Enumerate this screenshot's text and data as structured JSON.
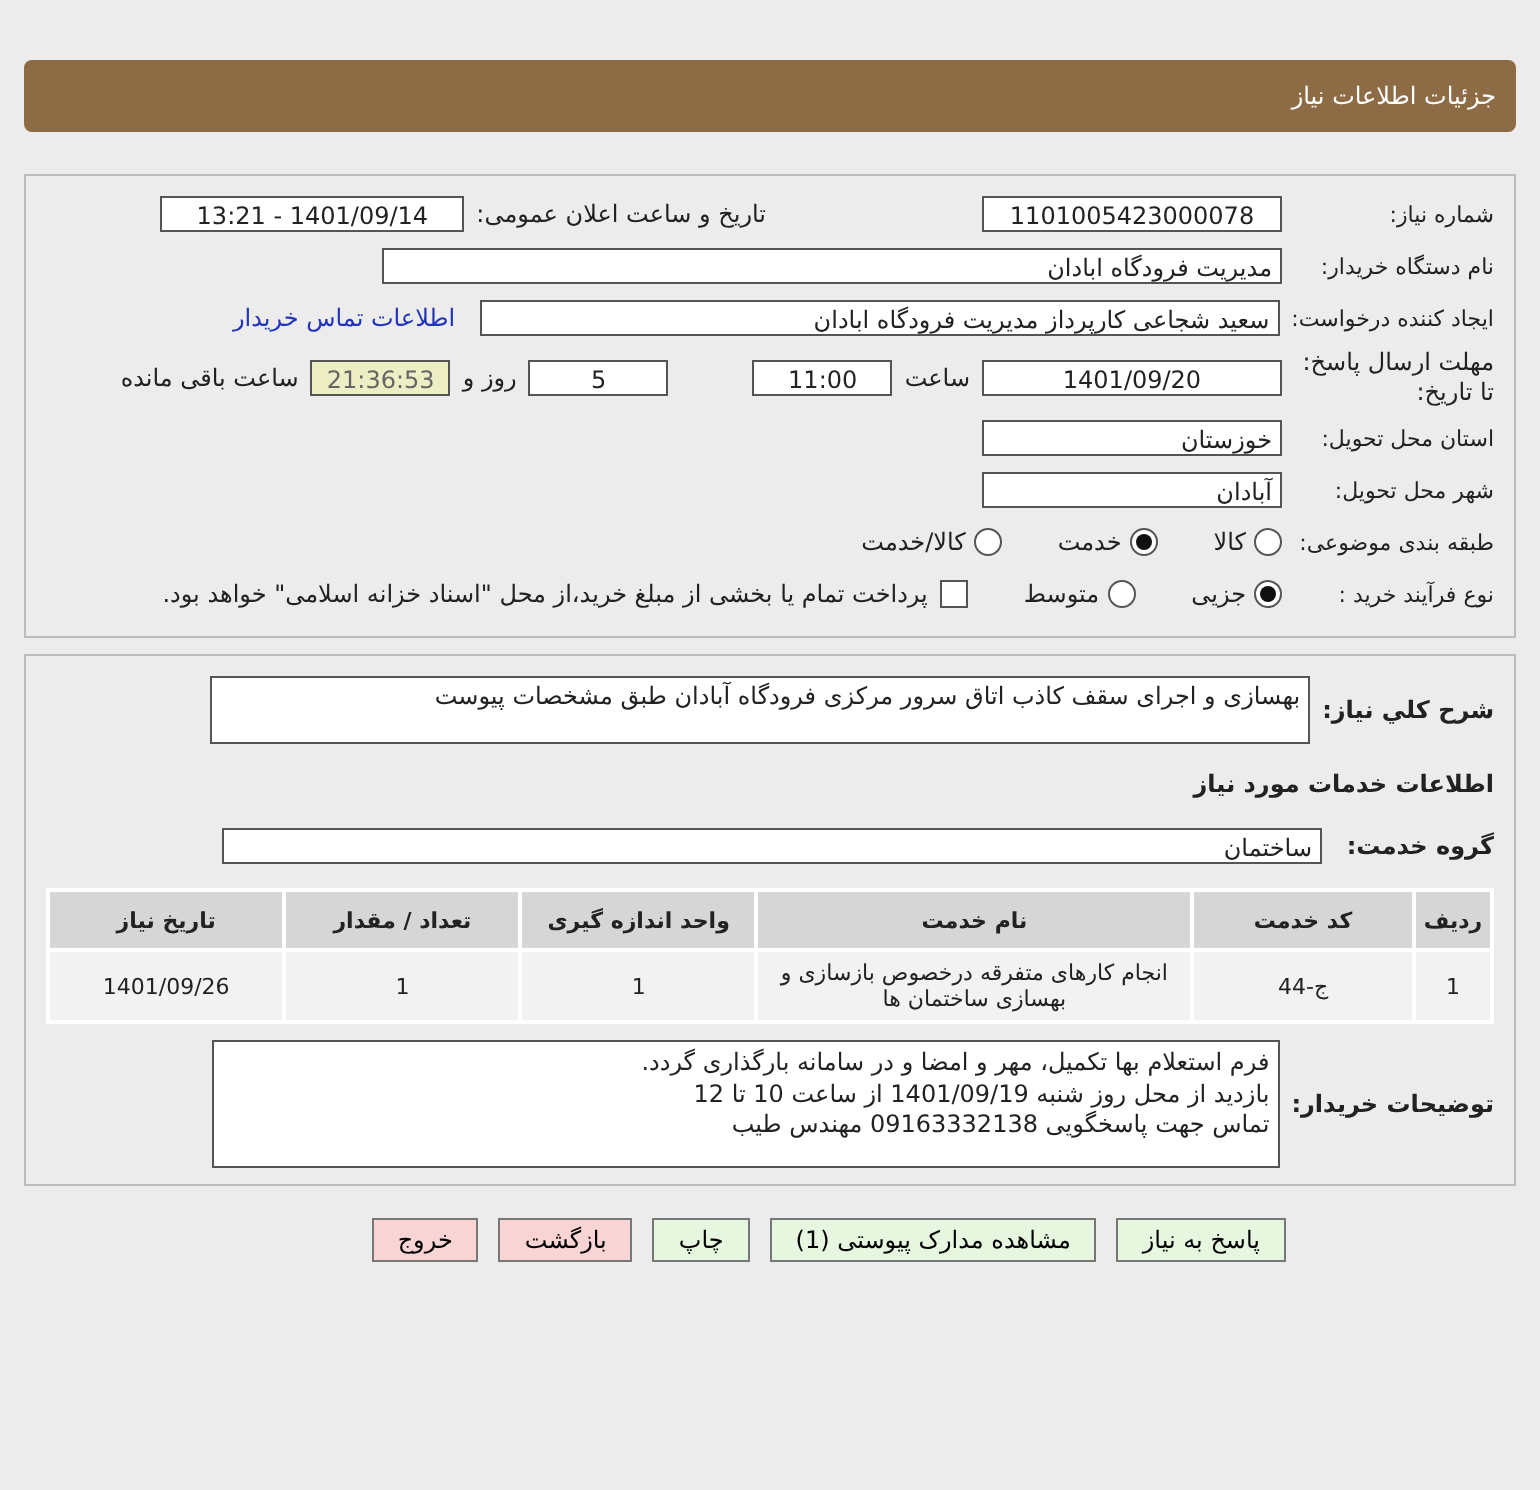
{
  "header": {
    "title": "جزئیات اطلاعات نیاز"
  },
  "need_number": {
    "label": "شماره نیاز:",
    "value": "1101005423000078"
  },
  "announce_datetime": {
    "label": "تاریخ و ساعت اعلان عمومی:",
    "value": "1401/09/14 - 13:21"
  },
  "buyer_org": {
    "label": "نام دستگاه خریدار:",
    "value": "مدیریت فرودگاه ابادان"
  },
  "requester": {
    "label": "ایجاد کننده درخواست:",
    "value": "سعید شجاعی کارپرداز مدیریت فرودگاه ابادان",
    "link": "اطلاعات تماس خریدار"
  },
  "deadline": {
    "label": "مهلت ارسال پاسخ: تا تاریخ:",
    "date": "1401/09/20",
    "time_label": "ساعت",
    "time": "11:00",
    "days": "5",
    "days_label": "روز و",
    "remaining": "21:36:53",
    "remaining_label": "ساعت باقی مانده"
  },
  "province": {
    "label": "استان محل تحویل:",
    "value": "خوزستان"
  },
  "city": {
    "label": "شهر محل تحویل:",
    "value": "آبادان"
  },
  "category": {
    "label": "طبقه بندی موضوعی:",
    "options": [
      {
        "label": "کالا",
        "selected": false
      },
      {
        "label": "خدمت",
        "selected": true
      },
      {
        "label": "کالا/خدمت",
        "selected": false
      }
    ]
  },
  "purchase_process": {
    "label": "نوع فرآیند خرید :",
    "options": [
      {
        "label": "جزیی",
        "selected": true
      },
      {
        "label": "متوسط",
        "selected": false
      }
    ],
    "payment": {
      "label": "پرداخت تمام یا بخشی از مبلغ خرید،از محل \"اسناد خزانه اسلامی\" خواهد بود.",
      "checked": false
    }
  },
  "description": {
    "label": "شرح کلي نیاز:",
    "value": "بهسازی و اجرای سقف کاذب اتاق سرور مرکزی فرودگاه آبادان طبق مشخصات پیوست"
  },
  "services_title": "اطلاعات خدمات مورد نیاز",
  "service_group": {
    "label": "گروه خدمت:",
    "value": "ساختمان"
  },
  "table": {
    "columns": [
      "ردیف",
      "کد خدمت",
      "نام خدمت",
      "واحد اندازه گیری",
      "تعداد / مقدار",
      "تاریخ نیاز"
    ],
    "rows": [
      [
        "1",
        "ج-44",
        "انجام کارهای متفرقه درخصوص بازسازی و بهسازی ساختمان ها",
        "1",
        "1",
        "1401/09/26"
      ]
    ]
  },
  "buyer_notes": {
    "label": "توضیحات خریدار:",
    "lines": [
      "فرم استعلام بها تکمیل، مهر و امضا و در سامانه بارگذاری گردد.",
      "بازدید از محل روز شنبه 1401/09/19 از ساعت 10 تا 12",
      "تماس جهت پاسخگویی 09163332138 مهندس طیب"
    ]
  },
  "buttons": [
    {
      "label": "پاسخ به نیاز",
      "kind": "action"
    },
    {
      "label": "مشاهده مدارک پیوستی (1)",
      "kind": "action"
    },
    {
      "label": "چاپ",
      "kind": "action"
    },
    {
      "label": "بازگشت",
      "kind": "exit"
    },
    {
      "label": "خروج",
      "kind": "exit"
    }
  ]
}
